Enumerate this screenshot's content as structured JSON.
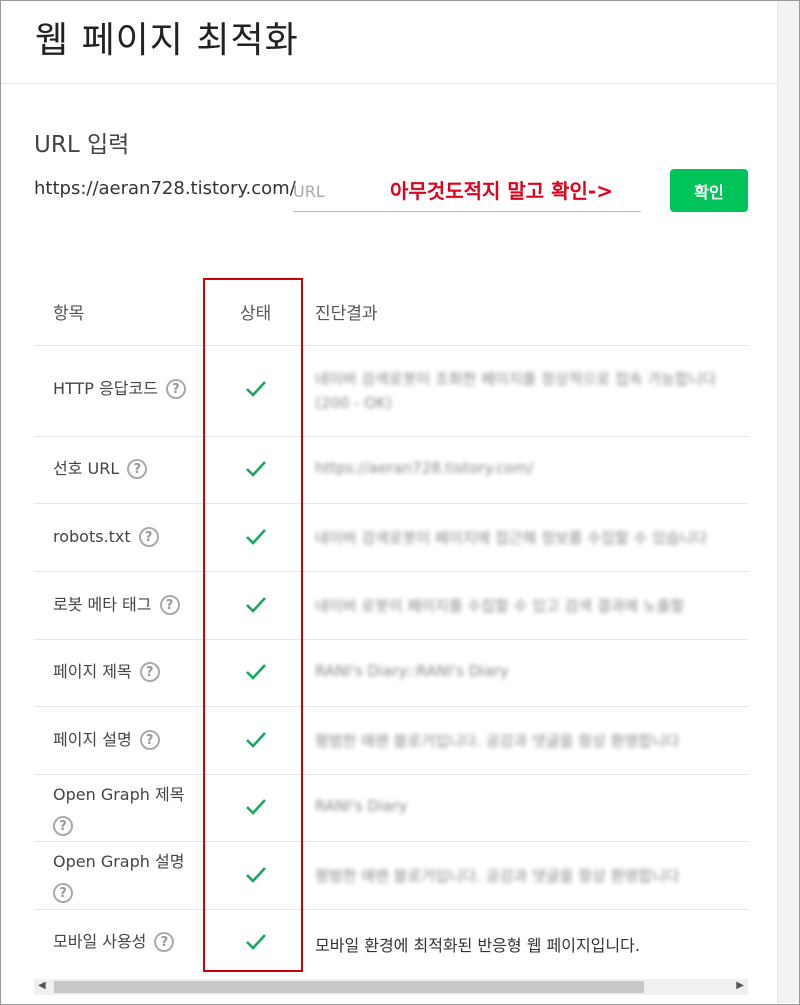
{
  "page_title": "웹 페이지 최적화",
  "url_section": {
    "label": "URL 입력",
    "site_prefix": "https://aeran728.tistory.com/",
    "placeholder": "URL",
    "annotation": "아무것도적지 말고 확인->",
    "confirm_label": "확인"
  },
  "table": {
    "headers": {
      "item": "항목",
      "status": "상태",
      "result": "진단결과"
    },
    "rows": [
      {
        "label": "HTTP 응답코드",
        "result": "네이버 검색로봇이 조회한 페이지를 정상적으로 접속 가능합니다 (200 - OK)",
        "status": "ok"
      },
      {
        "label": "선호 URL",
        "result": "https://aeran728.tistory.com/",
        "status": "ok"
      },
      {
        "label": "robots.txt",
        "result": "네이버 검색로봇이 페이지에 접근해 정보를 수집할 수 있습니다",
        "status": "ok"
      },
      {
        "label": "로봇 메타 태그",
        "result": "네이버 로봇이 페이지를 수집할 수 있고 검색 결과에 노출할",
        "status": "ok"
      },
      {
        "label": "페이지 제목",
        "result": "RANI's Diary::RANI's Diary",
        "status": "ok"
      },
      {
        "label": "페이지 설명",
        "result": "평범한 애랜 블로거입니다. 공감과 댓글을 항상 환영합니다",
        "status": "ok"
      },
      {
        "label": "Open Graph 제목",
        "result": "RANI's Diary",
        "status": "ok"
      },
      {
        "label": "Open Graph 설명",
        "result": "평범한 애랜 블로거입니다. 공감과 댓글을 항상 환영합니다",
        "status": "ok"
      },
      {
        "label": "모바일 사용성",
        "result": "모바일 환경에 최적화된 반응형 웹 페이지입니다.",
        "status": "ok"
      }
    ]
  },
  "colors": {
    "accent": "#00c45a",
    "check": "#1aa760",
    "annotation": "#e0001b",
    "highlight": "#d10000"
  },
  "icons": {
    "help": "question-circle-icon",
    "status_ok": "checkmark-icon"
  }
}
